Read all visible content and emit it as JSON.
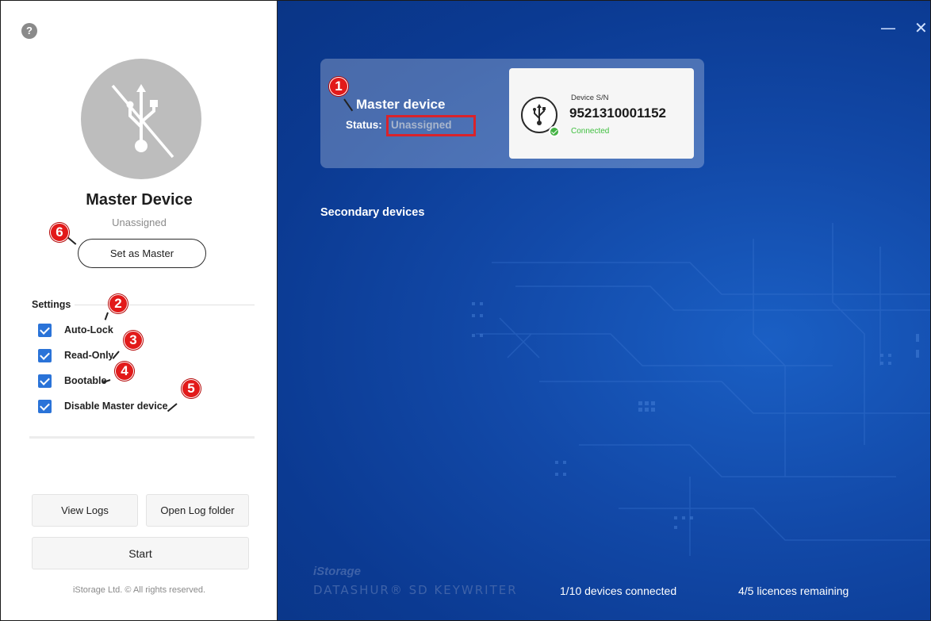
{
  "sidebar": {
    "help_icon": "question-mark-icon",
    "master_title": "Master Device",
    "master_status": "Unassigned",
    "set_master_label": "Set as Master",
    "settings_label": "Settings",
    "options": [
      {
        "label": "Auto-Lock",
        "checked": true
      },
      {
        "label": "Read-Only",
        "checked": true
      },
      {
        "label": "Bootable",
        "checked": true
      },
      {
        "label": "Disable Master device",
        "checked": true
      }
    ],
    "view_logs_label": "View Logs",
    "open_log_folder_label": "Open Log folder",
    "start_label": "Start",
    "copyright": "iStorage Ltd. © All rights reserved."
  },
  "main": {
    "minimize_glyph": "—",
    "close_glyph": "✕",
    "master": {
      "title": "Master device",
      "status_label": "Status:",
      "status_value": "Unassigned"
    },
    "device": {
      "sn_label": "Device S/N",
      "sn": "9521310001152",
      "state": "Connected"
    },
    "secondary_label": "Secondary devices",
    "brand_line1": "iStorage",
    "brand_line2": "DATASHUR® SD KEYWRITER",
    "devices_connected": "1/10 devices connected",
    "licences_remaining": "4/5 licences remaining"
  },
  "markers": [
    "1",
    "2",
    "3",
    "4",
    "5",
    "6"
  ],
  "colors": {
    "accent_blue": "#2a73d8",
    "main_bg": "#1249a8",
    "marker_red": "#e21a1a",
    "connected_green": "#3fbf3f"
  }
}
